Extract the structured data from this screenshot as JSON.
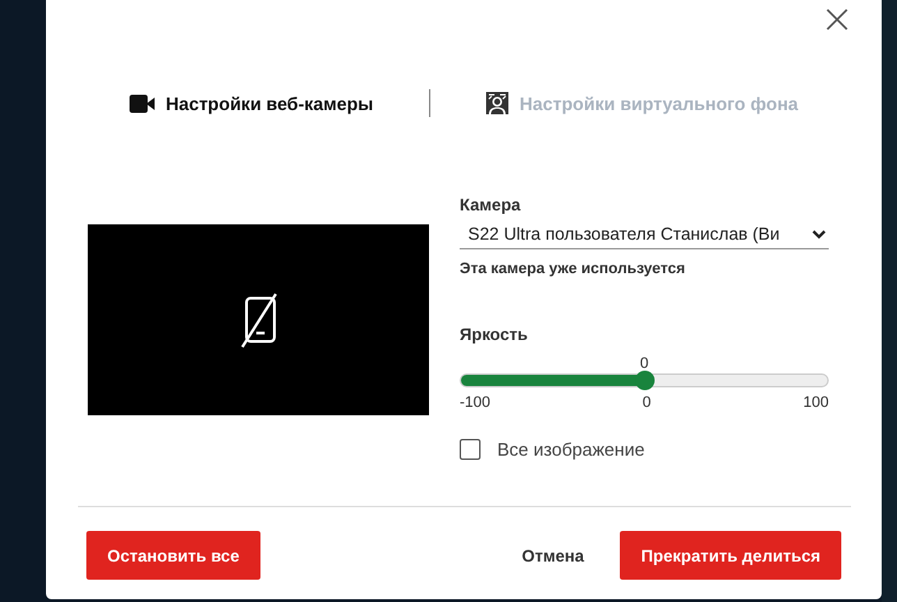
{
  "tabs": [
    {
      "label": "Настройки веб-камеры",
      "kind": "camera",
      "selected": true
    },
    {
      "label": "Настройки виртуального фона",
      "kind": "background",
      "selected": false
    }
  ],
  "camera": {
    "label": "Камера",
    "value": "S22 Ultra пользователя Станислав (Ви",
    "note": "Эта камера уже используется"
  },
  "brightness": {
    "label": "Яркость",
    "reading": "0",
    "level": 0.5,
    "min": "-100",
    "mid": "0",
    "max": "100"
  },
  "whole_image": {
    "label": "Все изображение",
    "checked": false
  },
  "buttons": [
    {
      "label": "Остановить все",
      "kind": "primary"
    },
    {
      "label": "Отмена",
      "kind": "plain"
    },
    {
      "label": "Прекратить делиться",
      "kind": "primary"
    }
  ]
}
